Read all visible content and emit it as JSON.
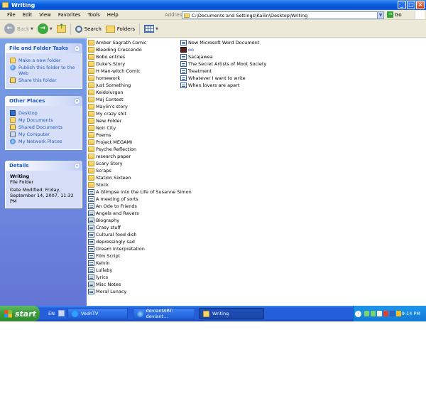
{
  "window": {
    "title": "Writing"
  },
  "menu": {
    "items": [
      "File",
      "Edit",
      "View",
      "Favorites",
      "Tools",
      "Help"
    ],
    "address_label": "Address",
    "address_value": "C:\\Documents and Settings\\Kailin\\Desktop\\Writing",
    "go_label": "Go"
  },
  "toolbar": {
    "back_label": "Back",
    "search_label": "Search",
    "folders_label": "Folders"
  },
  "task_pane": {
    "file_folder_tasks": {
      "title": "File and Folder Tasks",
      "items": [
        "Make a new folder",
        "Publish this folder to the Web",
        "Share this folder"
      ]
    },
    "other_places": {
      "title": "Other Places",
      "items": [
        "Desktop",
        "My Documents",
        "Shared Documents",
        "My Computer",
        "My Network Places"
      ]
    },
    "details": {
      "title": "Details",
      "name": "Writing",
      "type": "File Folder",
      "modified": "Date Modified: Friday, September 14, 2007, 11:32 PM"
    }
  },
  "files": {
    "column1": [
      {
        "name": "Amber Sagrath Comic",
        "icon": "folder-icon"
      },
      {
        "name": "Bleeding Crescendo",
        "icon": "folder-icon"
      },
      {
        "name": "Bobo entries",
        "icon": "folder-icon"
      },
      {
        "name": "Duke's Story",
        "icon": "folder-icon"
      },
      {
        "name": "H Man-witch Comic",
        "icon": "folder-icon"
      },
      {
        "name": "homework",
        "icon": "folder-icon"
      },
      {
        "name": "Just Something",
        "icon": "folder-icon"
      },
      {
        "name": "Keidolurgon",
        "icon": "folder-icon"
      },
      {
        "name": "Maj Contest",
        "icon": "folder-icon"
      },
      {
        "name": "Maylin's story",
        "icon": "folder-icon"
      },
      {
        "name": "My crazy shit",
        "icon": "folder-icon"
      },
      {
        "name": "New Folder",
        "icon": "folder-icon"
      },
      {
        "name": "Noir City",
        "icon": "folder-icon"
      },
      {
        "name": "Poems",
        "icon": "folder-icon"
      },
      {
        "name": "Project MEGAMI",
        "icon": "folder-icon"
      },
      {
        "name": "Psyche Reflection",
        "icon": "folder-icon"
      },
      {
        "name": "research paper",
        "icon": "folder-icon"
      },
      {
        "name": "Scary Story",
        "icon": "folder-icon"
      },
      {
        "name": "Scraps",
        "icon": "folder-icon"
      },
      {
        "name": "Station Sixteen",
        "icon": "folder-icon"
      },
      {
        "name": "Stock",
        "icon": "folder-icon"
      },
      {
        "name": "A Glimpse into the Life of Susanne Simon",
        "icon": "word-doc-icon"
      },
      {
        "name": "A meeting of sorts",
        "icon": "word-doc-icon"
      },
      {
        "name": "An Ode to Friends",
        "icon": "word-doc-icon"
      },
      {
        "name": "Angels and Ravers",
        "icon": "word-doc-icon"
      },
      {
        "name": "Biography",
        "icon": "word-doc-icon"
      },
      {
        "name": "Crasy stuff",
        "icon": "word-doc-icon"
      },
      {
        "name": "Cultural food dish",
        "icon": "word-doc-icon"
      },
      {
        "name": "depressingly sad",
        "icon": "word-doc-icon"
      },
      {
        "name": "Dream Interpretation",
        "icon": "word-doc-icon"
      },
      {
        "name": "Film Script",
        "icon": "word-doc-icon"
      },
      {
        "name": "Kelvin",
        "icon": "word-doc-icon"
      },
      {
        "name": "Lullaby",
        "icon": "word-doc-icon"
      },
      {
        "name": "lyrics",
        "icon": "word-doc-icon"
      },
      {
        "name": "Misc Notes",
        "icon": "word-doc-icon"
      },
      {
        "name": "Moral Lunacy",
        "icon": "word-doc-icon"
      }
    ],
    "column2": [
      {
        "name": "New Microsoft Word Document",
        "icon": "word-doc-icon"
      },
      {
        "name": "oo",
        "icon": "special-file-icon"
      },
      {
        "name": "Sacajawea",
        "icon": "word-doc-icon"
      },
      {
        "name": "The Secret Artists of Moot Society",
        "icon": "word-doc-icon"
      },
      {
        "name": "Treatment",
        "icon": "word-doc-icon"
      },
      {
        "name": "Whatever I want to write",
        "icon": "word-doc-icon"
      },
      {
        "name": "When lovers are apart",
        "icon": "word-doc-icon"
      }
    ]
  },
  "taskbar": {
    "start_label": "start",
    "language": "EN",
    "tasks": [
      {
        "label": "VeohTV",
        "icon": "veoh-icon"
      },
      {
        "label": "deviantART: deviant...",
        "icon": "ie-icon"
      },
      {
        "label": "Writing",
        "icon": "folder-icon"
      }
    ],
    "clock": "9:14 PM"
  },
  "colors": {
    "titlebar": "#0a5ee0",
    "taskpane_link": "#215dc6",
    "start_green": "#3c9a3c"
  }
}
